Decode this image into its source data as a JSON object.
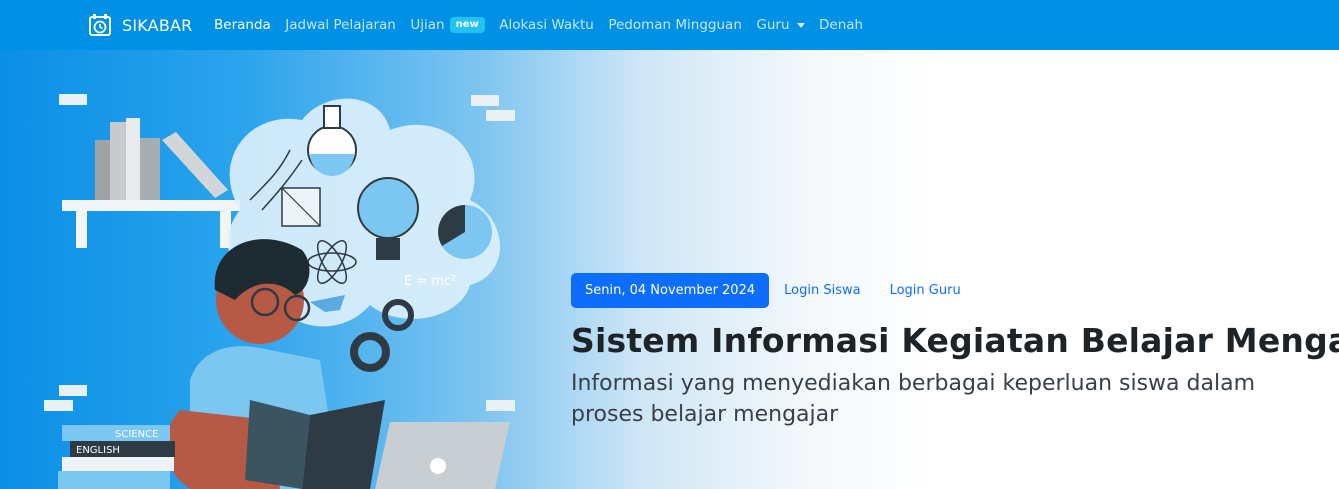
{
  "navbar": {
    "brand": {
      "name": "SIKABAR",
      "icon": "alarm-clock-icon"
    },
    "links": [
      {
        "label": "Beranda",
        "active": true
      },
      {
        "label": "Jadwal Pelajaran"
      },
      {
        "label": "Ujian",
        "badge": "new"
      },
      {
        "label": "Alokasi Waktu"
      },
      {
        "label": "Pedoman Mingguan"
      },
      {
        "label": "Guru",
        "dropdown": true
      },
      {
        "label": "Denah"
      }
    ],
    "colors": {
      "background": "#0090e6",
      "badge": "#22c3f0"
    }
  },
  "hero": {
    "date": "Senin, 04 November 2024",
    "login_siswa": "Login Siswa",
    "login_guru": "Login Guru",
    "title": "Sistem Informasi Kegiatan Belajar Mengajar",
    "subtitle": "Informasi yang menyediakan berbagai keperluan siswa dalam proses belajar mengajar",
    "illustration": {
      "formula": "E = mc²",
      "book_labels": [
        "SCIENCE",
        "ENGLISH"
      ]
    },
    "colors": {
      "primary": "#0d6efd",
      "title": "#1e2327"
    }
  }
}
